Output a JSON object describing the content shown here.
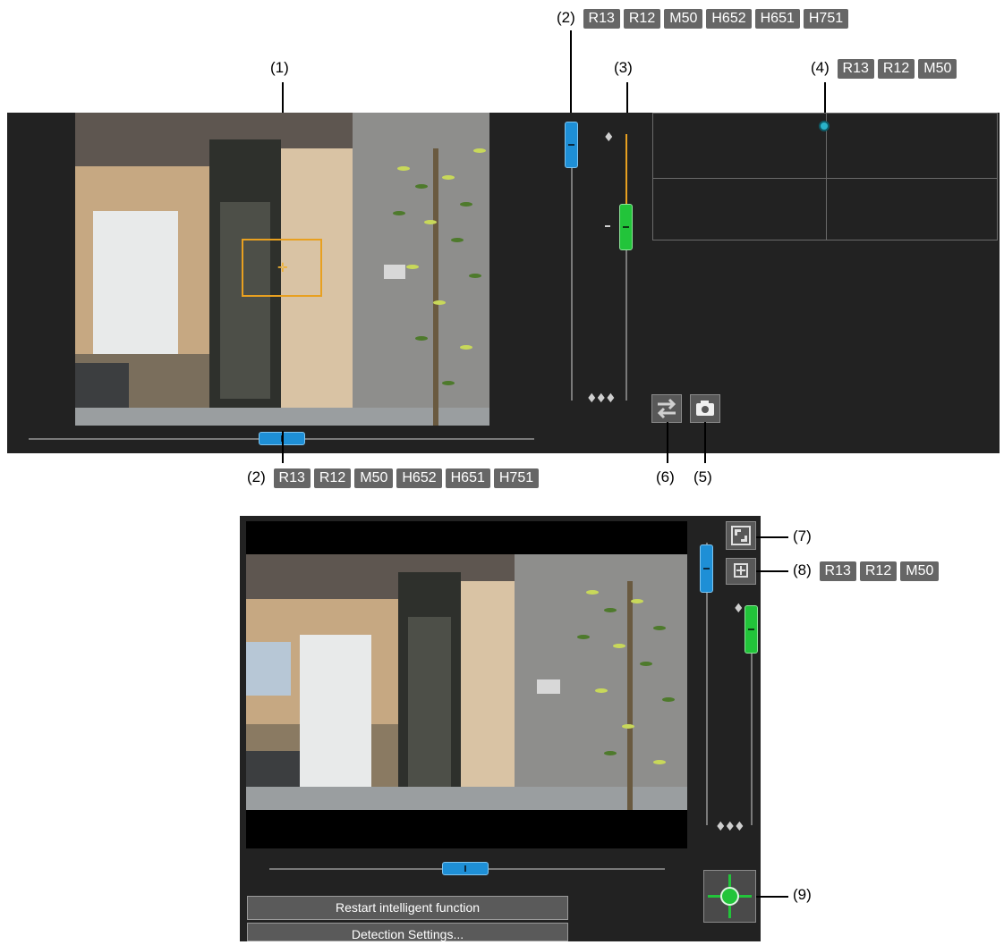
{
  "callouts": {
    "c1": {
      "label": "(1)"
    },
    "c2_top": {
      "label": "(2)",
      "badges": [
        "R13",
        "R12",
        "M50",
        "H652",
        "H651",
        "H751"
      ]
    },
    "c2_bottom": {
      "label": "(2)",
      "badges": [
        "R13",
        "R12",
        "M50",
        "H652",
        "H651",
        "H751"
      ]
    },
    "c3": {
      "label": "(3)"
    },
    "c4": {
      "label": "(4)",
      "badges": [
        "R13",
        "R12",
        "M50"
      ]
    },
    "c5": {
      "label": "(5)"
    },
    "c6": {
      "label": "(6)"
    },
    "c7": {
      "label": "(7)"
    },
    "c8": {
      "label": "(8)",
      "badges": [
        "R13",
        "R12",
        "M50"
      ]
    },
    "c9": {
      "label": "(9)"
    }
  },
  "buttons": {
    "restart": "Restart intelligent function",
    "detection": "Detection Settings..."
  },
  "icons": {
    "focus_near": "near-focus-icon",
    "focus_far": "far-focus-icon",
    "switch": "switch-arrows-icon",
    "snapshot": "camera-icon",
    "fullscreen": "fullscreen-icon",
    "add": "plus-icon",
    "pantilt": "pan-tilt-control-icon"
  },
  "colors": {
    "panel": "#222222",
    "accent_blue": "#1e8fd6",
    "accent_green": "#22c43a",
    "badge": "#666666",
    "frame_orange": "#e8a020"
  }
}
